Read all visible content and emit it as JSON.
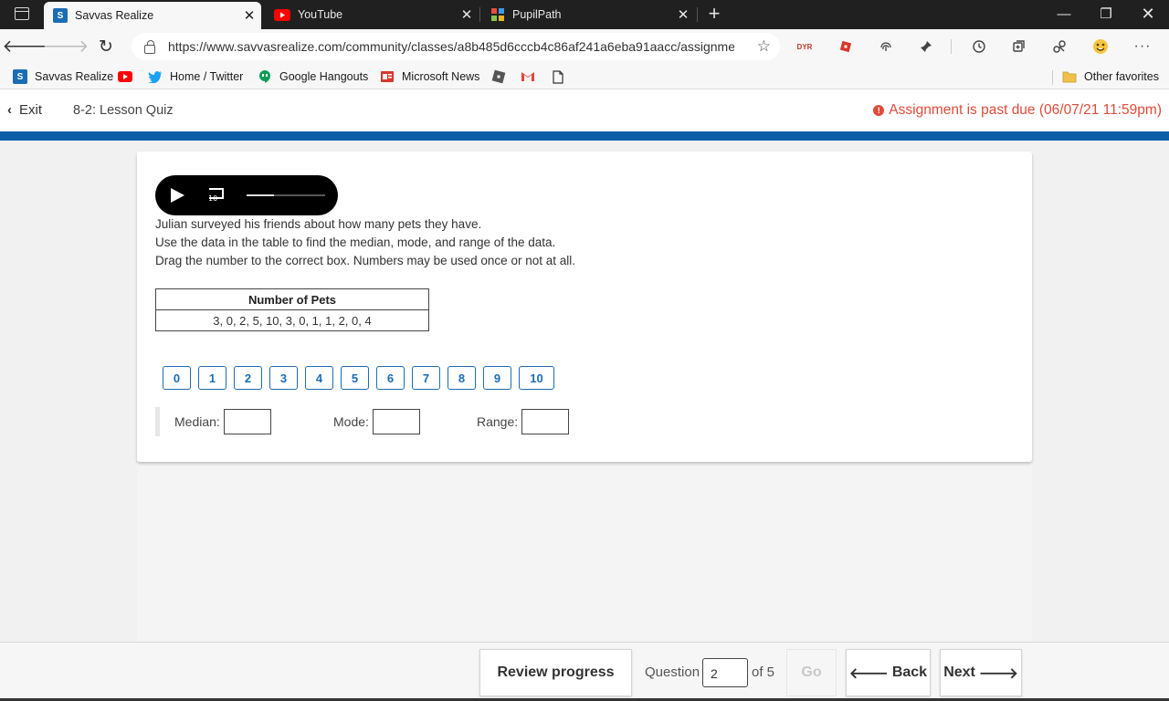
{
  "browser": {
    "tabs": [
      {
        "title": "Savvas Realize",
        "favicon": "savvas-icon",
        "active": true
      },
      {
        "title": "YouTube",
        "favicon": "youtube-icon",
        "active": false
      },
      {
        "title": "PupilPath",
        "favicon": "pupilpath-icon",
        "active": false
      }
    ],
    "url": "https://www.savvasrealize.com/community/classes/a8b485d6cccb4c86af241a6eba91aacc/assignme...",
    "extension_icon_labels": [
      "DYR"
    ],
    "favorites": [
      {
        "label": "Savvas Realize",
        "icon": "savvas-icon"
      },
      {
        "label": "",
        "icon": "youtube-icon"
      },
      {
        "label": "Home / Twitter",
        "icon": "twitter-icon"
      },
      {
        "label": "Google Hangouts",
        "icon": "hangouts-icon"
      },
      {
        "label": "Microsoft News",
        "icon": "news-icon"
      },
      {
        "label": "",
        "icon": "roblox-icon"
      },
      {
        "label": "",
        "icon": "gmail-icon"
      },
      {
        "label": "",
        "icon": "document-icon"
      }
    ],
    "other_favorites": "Other favorites",
    "accent_colors": {
      "youtube": "#ff0000",
      "twitter": "#1da1f2",
      "savvas": "#1a6db5"
    }
  },
  "header": {
    "exit_label": "Exit",
    "quiz_title": "8-2: Lesson Quiz",
    "due_notice": "Assignment is past due (06/07/21 11:59pm)",
    "due_color": "#e04b39",
    "band_color": "#0d5fa8"
  },
  "question": {
    "audio_progress": 0.35,
    "rewind_label": "10",
    "lines": [
      "Julian surveyed his friends about how many pets they have.",
      "Use the data in the table to find the median, mode, and range of the data.",
      "Drag the number to the correct box. Numbers may be used once or not at all."
    ],
    "table": {
      "header": "Number of Pets",
      "values": "3, 0, 2, 5, 10, 3, 0, 1, 1, 2, 0, 4"
    },
    "tiles": [
      "0",
      "1",
      "2",
      "3",
      "4",
      "5",
      "6",
      "7",
      "8",
      "9",
      "10"
    ],
    "answers": {
      "median_label": "Median:",
      "mode_label": "Mode:",
      "range_label": "Range:"
    }
  },
  "footer": {
    "review_label": "Review progress",
    "question_label": "Question",
    "current_question": "2",
    "of_label": "of 5",
    "go_label": "Go",
    "back_label": "Back",
    "next_label": "Next"
  }
}
